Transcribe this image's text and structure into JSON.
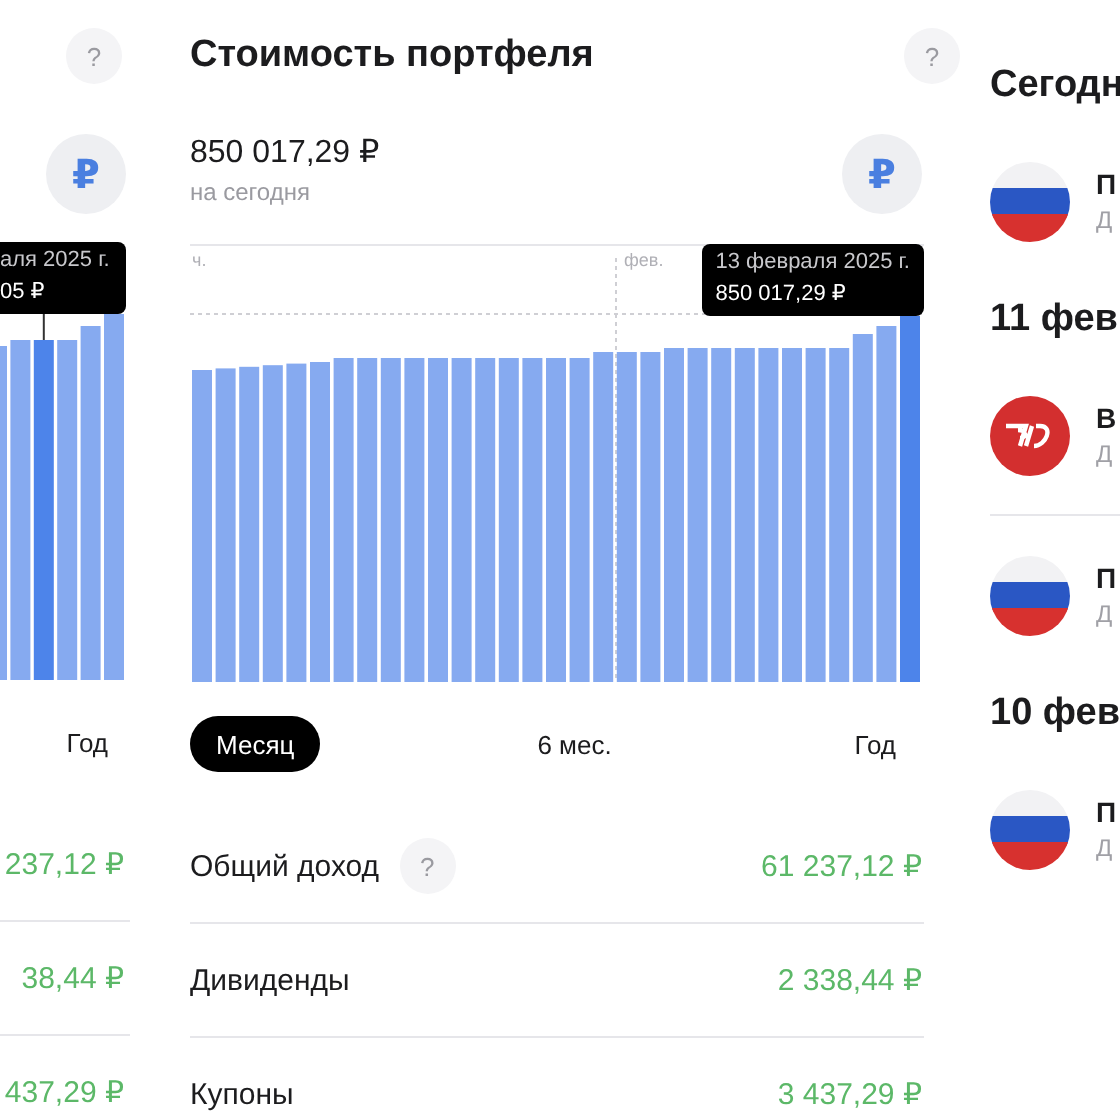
{
  "left_panel": {
    "help_button": "?",
    "currency_button": "₽",
    "tooltip": {
      "date": "аля 2025 г.",
      "value": "05 ₽"
    },
    "period_tab": {
      "label": "Год",
      "selected": false
    },
    "rows": [
      {
        "value": "237,12 ₽"
      },
      {
        "value": "38,44 ₽"
      },
      {
        "value": "437,29 ₽"
      }
    ]
  },
  "portfolio": {
    "title": "Стоимость портфеля",
    "help_button": "?",
    "currency_button": "₽",
    "value": "850 017,29 ₽",
    "caption": "на сегодня",
    "chart": {
      "month_labels": [
        "ч.",
        "фев."
      ],
      "tooltip": {
        "date": "13 февраля 2025 г.",
        "value": "850 017,29 ₽"
      }
    },
    "periods": [
      {
        "label": "Месяц",
        "selected": true
      },
      {
        "label": "6 мес.",
        "selected": false
      },
      {
        "label": "Год",
        "selected": false
      }
    ],
    "rows": [
      {
        "label": "Общий доход",
        "help": "?",
        "value": "61 237,12 ₽"
      },
      {
        "label": "Дивиденды",
        "value": "2 338,44 ₽"
      },
      {
        "label": "Купоны",
        "value": "3 437,29 ₽"
      }
    ]
  },
  "events": {
    "groups": [
      {
        "date": "Сегодн",
        "items": [
          {
            "kind": "flag",
            "title": "П",
            "subtitle": "Д"
          }
        ]
      },
      {
        "date": "11 фев",
        "items": [
          {
            "kind": "rail",
            "title": "В",
            "subtitle": "Д"
          },
          {
            "kind": "flag",
            "title": "П",
            "subtitle": "Д"
          }
        ]
      },
      {
        "date": "10 фев",
        "items": [
          {
            "kind": "flag",
            "title": "П",
            "subtitle": "Д"
          }
        ]
      }
    ]
  }
}
